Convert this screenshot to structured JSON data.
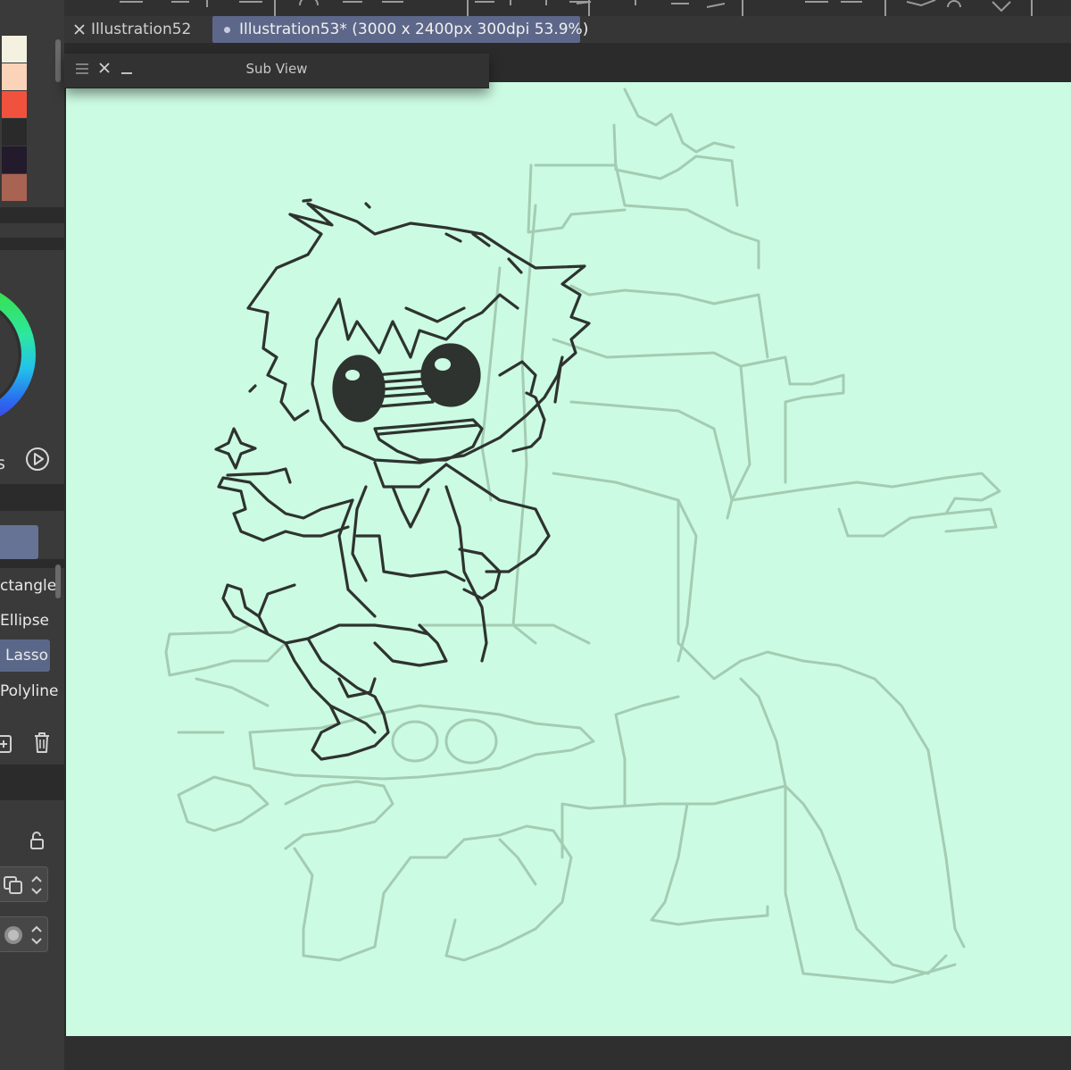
{
  "palette": {
    "swatches": [
      [
        "#e8325a",
        "#f4f1e0"
      ],
      [
        "#4a9ad0",
        "#fad3b8"
      ],
      [
        "#f9e38a",
        "#f1523e"
      ],
      [
        "#9a8676",
        "#2a2a2a"
      ],
      [
        "checker",
        "#231a2c"
      ],
      [
        "#2d2438",
        "#a96353"
      ]
    ]
  },
  "color_wheel": {
    "label": "s"
  },
  "tools": {
    "items": [
      {
        "label": "ctangle",
        "active": false
      },
      {
        "label": "Ellipse",
        "active": false
      },
      {
        "label": "Lasso",
        "active": true
      },
      {
        "label": "Polyline",
        "active": false
      }
    ]
  },
  "tabs": [
    {
      "label": "Illustration52",
      "active": false,
      "icon": "close-icon"
    },
    {
      "label": "Illustration53* (3000 x 2400px 300dpi 53.9%)",
      "active": true,
      "icon": "dot-icon"
    }
  ],
  "subview": {
    "title": "Sub View"
  },
  "canvas": {
    "background": "#ccfbe3",
    "sketch_color": "#2e332f",
    "rough_color": "#9fc7ad"
  }
}
